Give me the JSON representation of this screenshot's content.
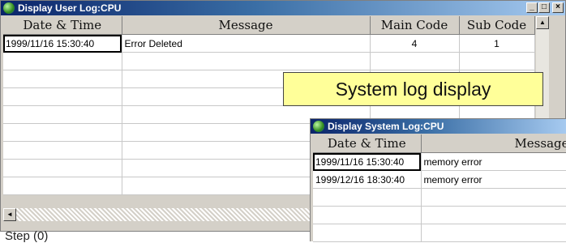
{
  "user_window": {
    "title": "Display User Log:CPU",
    "buttons": {
      "minimize": "_",
      "maximize": "□",
      "close": "×"
    },
    "columns": [
      "Date & Time",
      "Message",
      "Main Code",
      "Sub Code"
    ],
    "rows": [
      {
        "datetime": "1999/11/16 15:30:40",
        "message": "Error Deleted",
        "main_code": "4",
        "sub_code": "1"
      }
    ],
    "scroll_up": "▲",
    "scroll_left": "◄"
  },
  "status_text": "Step (0)",
  "callout": {
    "text": "System log display"
  },
  "system_window": {
    "title": "Display System Log:CPU",
    "columns": [
      "Date & Time",
      "Message"
    ],
    "rows": [
      {
        "datetime": "1999/11/16 15:30:40",
        "message": "memory error"
      },
      {
        "datetime": "1999/12/16 18:30:40",
        "message": "memory error"
      }
    ]
  }
}
